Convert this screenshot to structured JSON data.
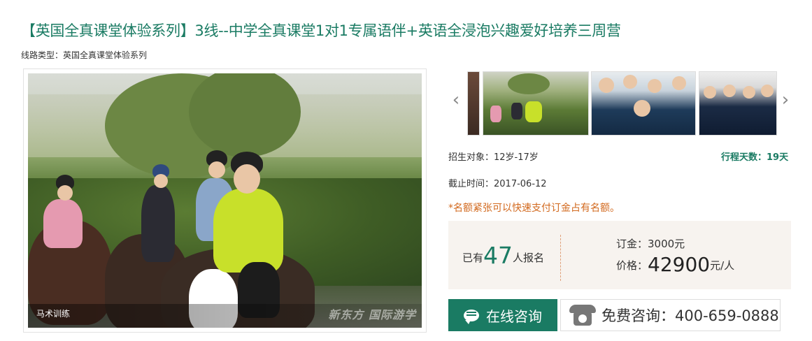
{
  "header": {
    "title": "【英国全真课堂体验系列】3线--中学全真课堂1对1专属语伴+英语全浸泡兴趣爱好培养三周营",
    "route_type": "线路类型：英国全真课堂体验系列"
  },
  "gallery": {
    "main_caption": "马术训练",
    "watermark": "新东方 国际游学",
    "prev_icon": "chevron-left-icon",
    "next_icon": "chevron-right-icon"
  },
  "info": {
    "target": "招生对象：12岁-17岁",
    "days": "行程天数：19天",
    "deadline": "截止时间：2017-06-12",
    "notice": "*名额紧张可以快速支付订金占有名额。"
  },
  "pricing": {
    "enrolled_prefix": "已有",
    "enrolled_count": "47",
    "enrolled_suffix": "人报名",
    "deposit": "订金：3000元",
    "price_label": "价格：",
    "price_value": "42900",
    "price_unit": "元/人"
  },
  "actions": {
    "consult_label": "在线咨询",
    "phone_label": "免费咨询：400-659-0888"
  },
  "colors": {
    "accent": "#1a7b63",
    "notice": "#d2691e",
    "price_bg": "#f7f3ef"
  }
}
